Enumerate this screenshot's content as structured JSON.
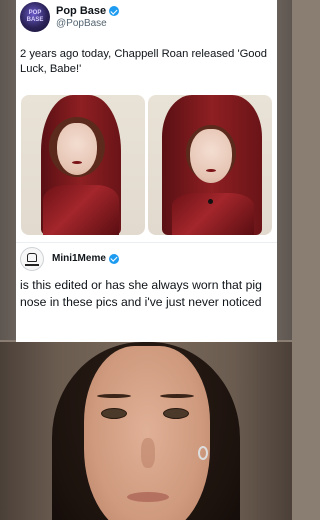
{
  "tweet": {
    "author_name": "Pop Base",
    "author_handle": "@PopBase",
    "avatar_text": "POP BASE",
    "text": "2 years ago today, Chappell Roan released 'Good Luck, Babe!'"
  },
  "reply": {
    "author_name": "Mini1Meme",
    "text": "is this edited or has she always worn that pig nose in these pics and i've just never noticed"
  },
  "colors": {
    "verified": "#1d9bf0",
    "text": "#0f1419",
    "secondary": "#536471"
  },
  "icons": {
    "verified": "verified-badge-icon"
  }
}
